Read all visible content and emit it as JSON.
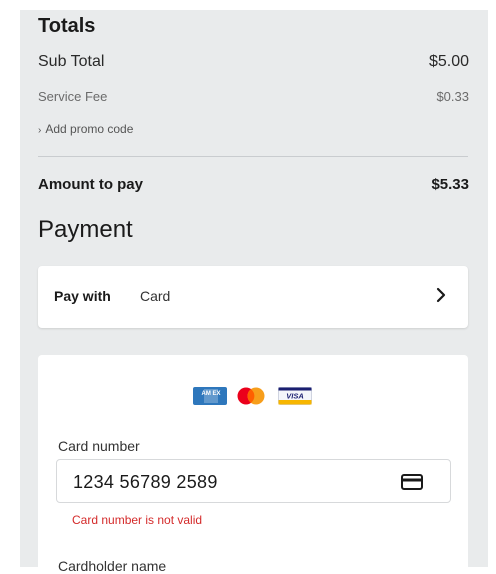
{
  "totals": {
    "title": "Totals",
    "subtotal_label": "Sub Total",
    "subtotal_value": "$5.00",
    "service_fee_label": "Service Fee",
    "service_fee_value": "$0.33",
    "promo_label": "Add promo code",
    "amount_label": "Amount to pay",
    "amount_value": "$5.33"
  },
  "payment": {
    "title": "Payment",
    "pay_with_label": "Pay with",
    "pay_with_value": "Card",
    "card_logos": [
      "amex-logo",
      "mastercard-logo",
      "visa-logo"
    ],
    "amex_text": "AM EX",
    "visa_text": "VISA",
    "card_number_label": "Card number",
    "card_number_value": "1234 56789 2589",
    "card_number_error": "Card number is not valid",
    "cardholder_label": "Cardholder name"
  },
  "colors": {
    "background": "#e9ebec",
    "error": "#d42a2a",
    "amex": "#2e77bc",
    "visa": "#1a1f71"
  }
}
